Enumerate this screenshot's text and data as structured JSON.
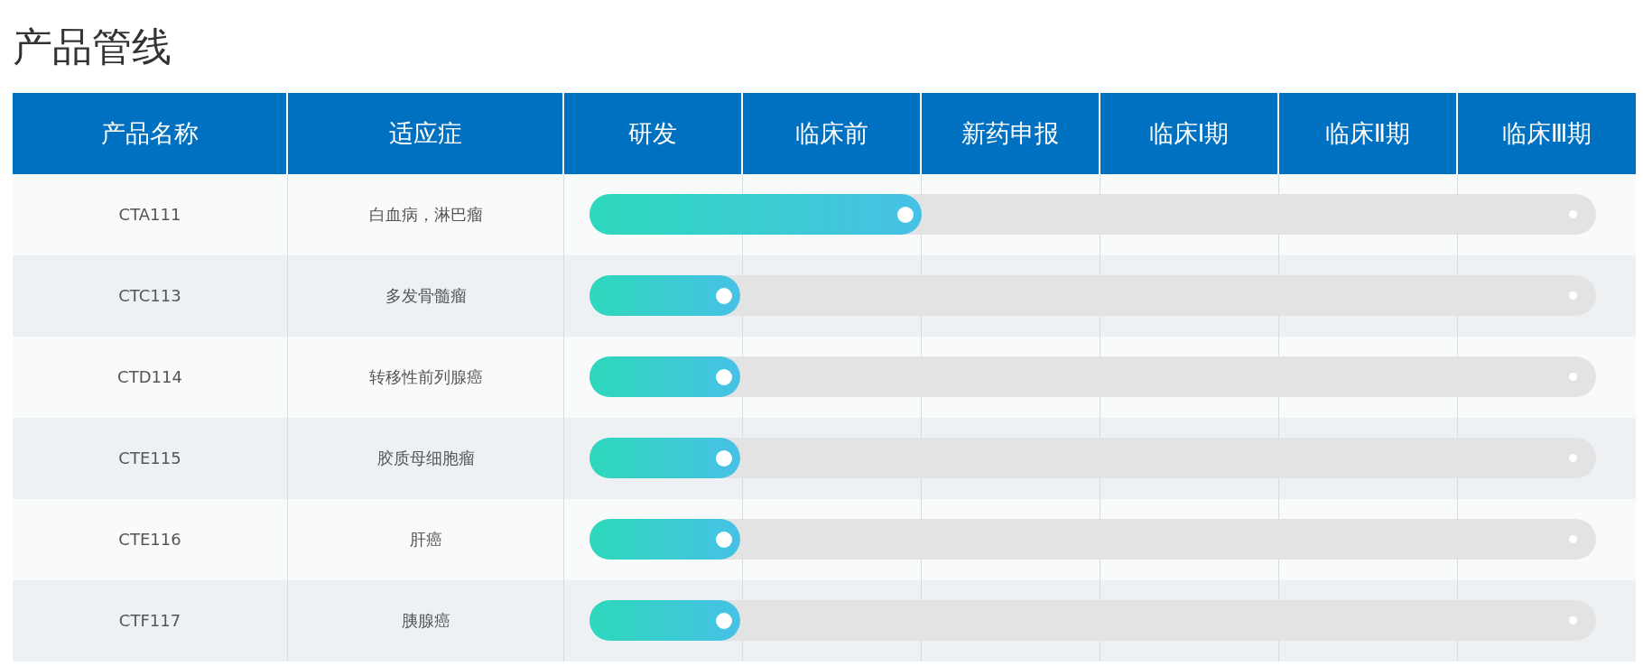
{
  "title": "产品管线",
  "columns": [
    "产品名称",
    "适应症",
    "研发",
    "临床前",
    "新药申报",
    "临床Ⅰ期",
    "临床Ⅱ期",
    "临床Ⅲ期"
  ],
  "rows": [
    {
      "product": "CTA111",
      "indication": "白血病，淋巴瘤",
      "level": 0.33
    },
    {
      "product": "CTC113",
      "indication": "多发骨髓瘤",
      "level": 0.15
    },
    {
      "product": "CTD114",
      "indication": "转移性前列腺癌",
      "level": 0.15
    },
    {
      "product": "CTE115",
      "indication": "胶质母细胞瘤",
      "level": 0.15
    },
    {
      "product": "CTE116",
      "indication": "肝癌",
      "level": 0.15
    },
    {
      "product": "CTF117",
      "indication": "胰腺癌",
      "level": 0.15
    }
  ]
}
